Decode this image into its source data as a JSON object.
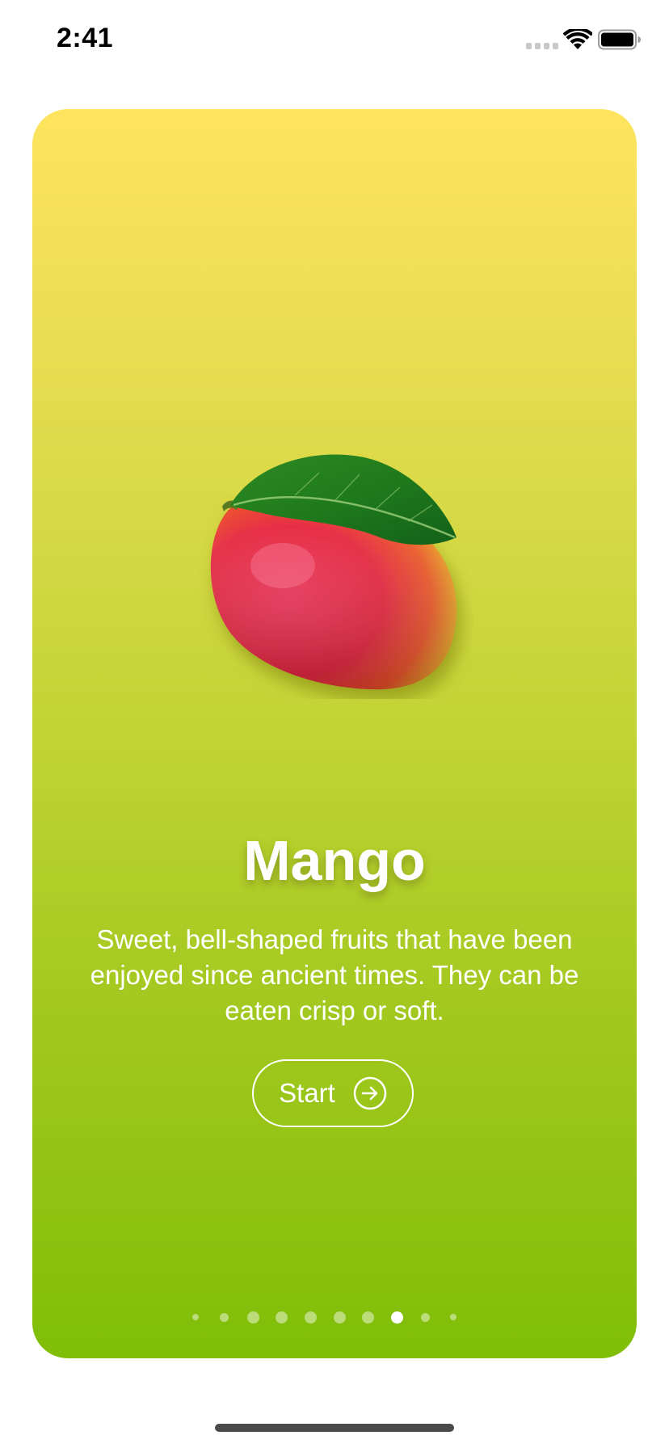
{
  "status_bar": {
    "time": "2:41",
    "icons": [
      "signal-icon",
      "wifi-icon",
      "battery-icon"
    ]
  },
  "card": {
    "gradient_top": "#ffe45e",
    "gradient_bottom": "#7fbe08",
    "image": "mango-image",
    "title": "Mango",
    "description": "Sweet, bell-shaped fruits that have been enjoyed since ancient times. They can be eaten crisp or soft.",
    "start_button": {
      "label": "Start",
      "icon": "arrow-right-circle-icon"
    }
  },
  "pagination": {
    "total": 10,
    "active_index": 7
  },
  "colors": {
    "text": "#ffffff",
    "active_dot": "#ffffff"
  }
}
